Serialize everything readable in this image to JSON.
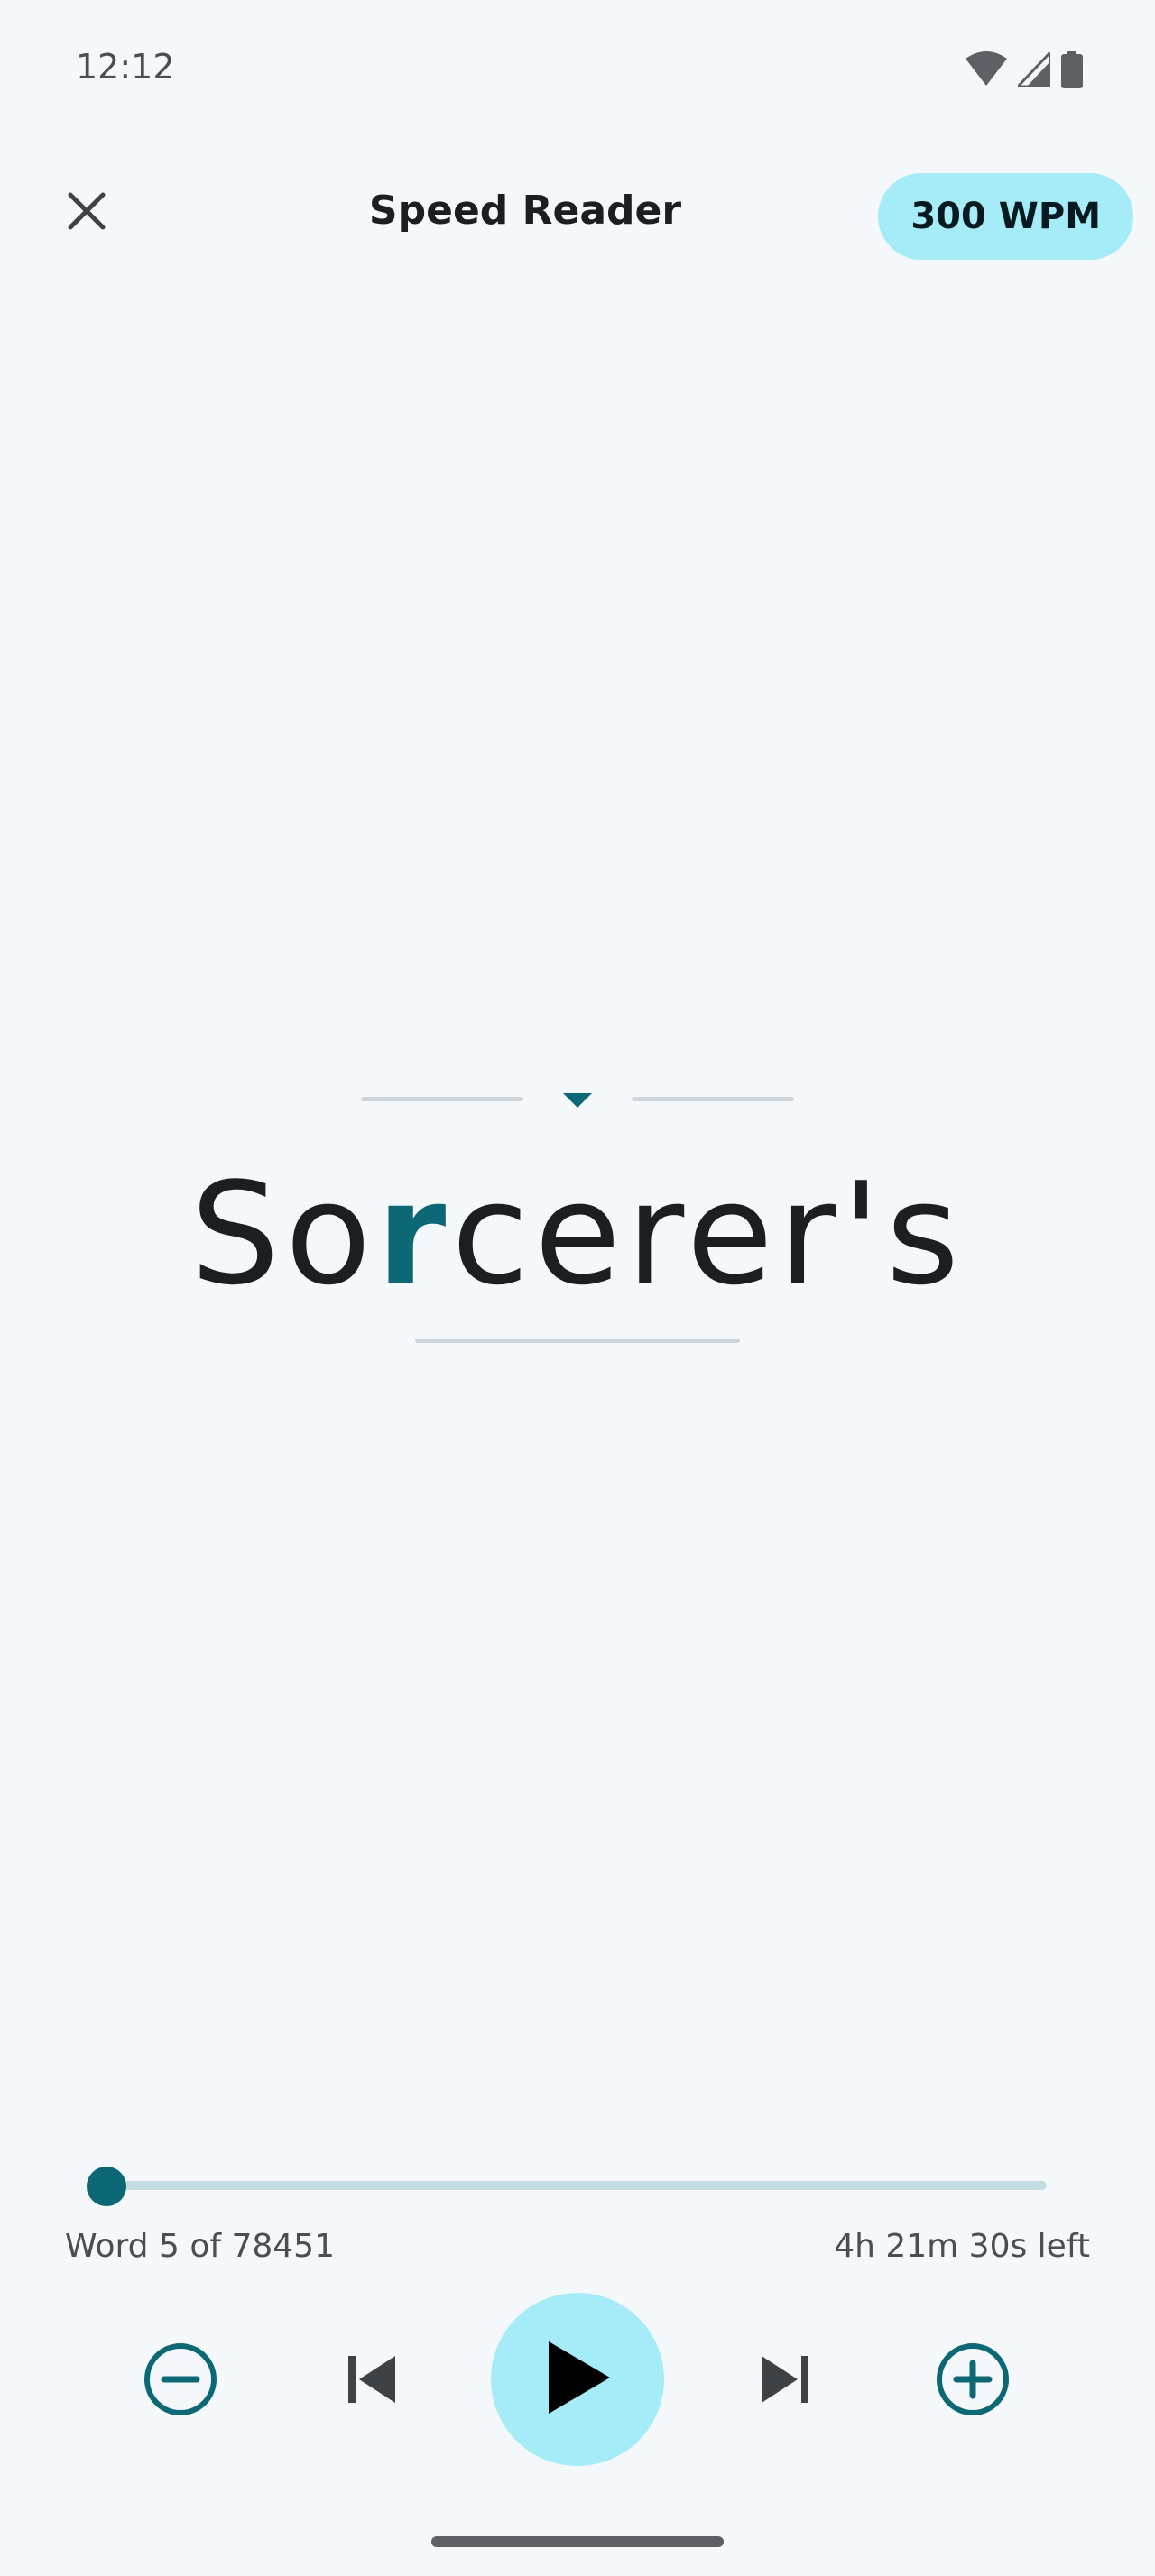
{
  "status_bar": {
    "time": "12:12",
    "icons": [
      "wifi-icon",
      "cell-signal-icon",
      "battery-icon"
    ]
  },
  "app_bar": {
    "close_icon": "close-icon",
    "title": "Speed Reader",
    "wpm_chip": "300 WPM"
  },
  "reader": {
    "word_prefix": "So",
    "word_focus_letter": "r",
    "word_suffix": "cerer's"
  },
  "progress": {
    "current_word": 5,
    "total_words": 78451,
    "word_label": "Word 5 of 78451",
    "time_left": "4h 21m 30s left"
  },
  "controls": {
    "slower_icon": "minus-circle-icon",
    "previous_icon": "skip-previous-icon",
    "play_icon": "play-icon",
    "next_icon": "skip-next-icon",
    "faster_icon": "plus-circle-icon"
  },
  "colors": {
    "accent": "#0b6874",
    "chip_bg": "#a6ecf8",
    "background": "#f4f8fb",
    "text": "#1b1f22",
    "muted": "#4a4f54"
  }
}
